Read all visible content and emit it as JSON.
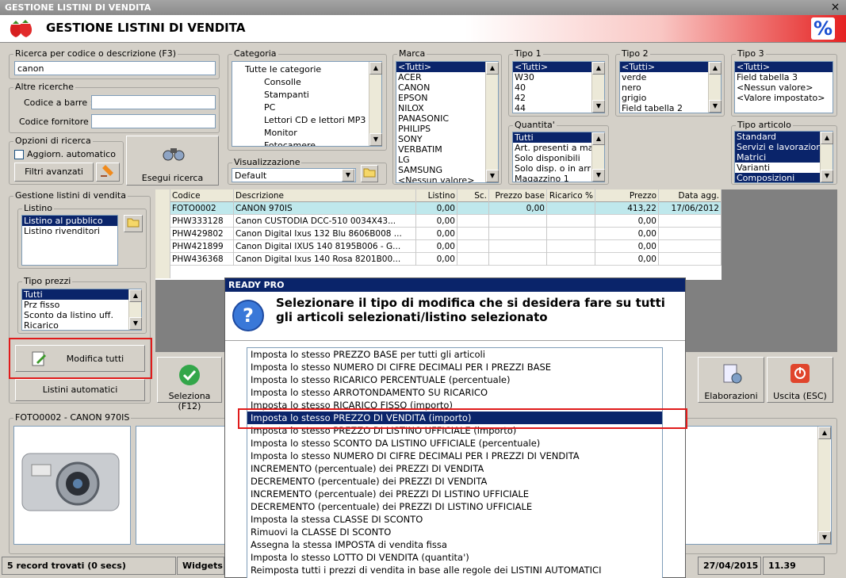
{
  "window": {
    "title": "GESTIONE LISTINI DI VENDITA",
    "close": "×"
  },
  "header": {
    "title": "GESTIONE LISTINI DI VENDITA",
    "logo": "strawberry",
    "percent_icon": "%"
  },
  "search": {
    "label": "Ricerca per codice o descrizione (F3)",
    "value": "canon"
  },
  "altre": {
    "label": "Altre ricerche",
    "barcode_label": "Codice a barre :",
    "supplier_label": "Codice fornitore :"
  },
  "opzioni": {
    "label": "Opzioni di ricerca",
    "auto_label": "Aggiorn. automatico",
    "filters_label": "Filtri avanzati"
  },
  "esegui": {
    "label": "Esegui ricerca"
  },
  "categoria": {
    "label": "Categoria",
    "items": [
      "Tutte le categorie",
      "Consolle",
      "Stampanti",
      "PC",
      "Lettori CD e lettori MP3",
      "Monitor",
      "Fotocamere"
    ]
  },
  "visualizzazione": {
    "label": "Visualizzazione",
    "value": "Default"
  },
  "marca": {
    "label": "Marca",
    "items": [
      "<Tutti>",
      "ACER",
      "CANON",
      "EPSON",
      "NILOX",
      "PANASONIC",
      "PHILIPS",
      "SONY",
      "VERBATIM",
      "LG",
      "SAMSUNG",
      "<Nessun valore>"
    ]
  },
  "tipo1": {
    "label": "Tipo 1",
    "items": [
      "<Tutti>",
      "W30",
      "40",
      "42",
      "44"
    ]
  },
  "tipo2": {
    "label": "Tipo 2",
    "items": [
      "<Tutti>",
      "verde",
      "nero",
      "grigio",
      "Field tabella 2"
    ]
  },
  "tipo3": {
    "label": "Tipo 3",
    "items": [
      "<Tutti>",
      "Field tabella 3",
      "<Nessun valore>",
      "<Valore impostato>"
    ]
  },
  "quantita": {
    "label": "Quantita'",
    "items": [
      "Tutti",
      "Art. presenti a maga",
      "Solo disponibili",
      "Solo disp. o in arrivo",
      "Magazzino 1"
    ]
  },
  "tipo_articolo": {
    "label": "Tipo articolo",
    "items": [
      "Standard",
      "Servizi e lavorazioni",
      "Matrici",
      "Varianti",
      "Composizioni"
    ]
  },
  "gestione": {
    "label": "Gestione listini di vendita",
    "listino_label": "Listino",
    "listino_items": [
      "Listino al pubblico",
      "Listino rivenditori"
    ],
    "tipo_prezzi_label": "Tipo prezzi",
    "tipo_prezzi_items": [
      "Tutti",
      "Prz fisso",
      "Sconto da listino uff.",
      "Ricarico"
    ],
    "modifica_label": "Modifica tutti",
    "automatici_label": "Listini automatici"
  },
  "grid": {
    "columns": [
      "Codice",
      "Descrizione",
      "Listino",
      "Sc.",
      "Prezzo base",
      "Ricarico %",
      "Prezzo",
      "Data agg."
    ],
    "rows": [
      [
        "FOTO0002",
        "CANON 970IS",
        "0,00",
        "",
        "0,00",
        "",
        "413,22",
        "17/06/2012"
      ],
      [
        "PHW333128",
        "Canon CUSTODIA DCC-510 0034X43...",
        "0,00",
        "",
        "",
        "",
        "0,00",
        ""
      ],
      [
        "PHW429802",
        "Canon Digital Ixus 132 Blu 8606B008 ...",
        "0,00",
        "",
        "",
        "",
        "0,00",
        ""
      ],
      [
        "PHW421899",
        "Canon Digital IXUS 140 8195B006 - G...",
        "0,00",
        "",
        "",
        "",
        "0,00",
        ""
      ],
      [
        "PHW436368",
        "Canon Digital Ixus 140 Rosa 8201B00...",
        "0,00",
        "",
        "",
        "",
        "0,00",
        ""
      ]
    ]
  },
  "buttons": {
    "seleziona": "Seleziona (F12)",
    "elaborazioni": "Elaborazioni",
    "uscita": "Uscita (ESC)"
  },
  "preview": {
    "label": "FOTO0002 - CANON 970IS"
  },
  "status": {
    "records": "5 record trovati (0 secs)",
    "widgets": "Widgets",
    "date": "27/04/2015",
    "time": "11.39"
  },
  "dialog": {
    "title": "READY PRO",
    "message": "Selezionare il tipo di modifica che si desidera fare su tutti gli articoli selezionati/listino selezionato",
    "options": [
      "Imposta lo stesso PREZZO BASE per tutti gli articoli",
      "Imposta lo stesso NUMERO DI CIFRE DECIMALI PER I PREZZI BASE",
      "Imposta lo stesso RICARICO PERCENTUALE (percentuale)",
      "Imposta lo stesso ARROTONDAMENTO SU RICARICO",
      "Imposta lo stesso RICARICO FISSO (importo)",
      "Imposta lo stesso PREZZO DI VENDITA (importo)",
      "Imposta lo stesso PREZZO DI LISTINO UFFICIALE (importo)",
      "Imposta lo stesso SCONTO DA LISTINO UFFICIALE (percentuale)",
      "Imposta lo stesso NUMERO DI CIFRE DECIMALI PER I PREZZI DI VENDITA",
      "INCREMENTO (percentuale) dei PREZZI DI VENDITA",
      "DECREMENTO (percentuale) dei PREZZI DI VENDITA",
      "INCREMENTO (percentuale) dei PREZZI DI LISTINO UFFICIALE",
      "DECREMENTO (percentuale) dei PREZZI DI LISTINO UFFICIALE",
      "Imposta la stessa CLASSE DI SCONTO",
      "Rimuovi la CLASSE DI SCONTO",
      "Assegna la stessa IMPOSTA di vendita fissa",
      "Imposta lo stesso LOTTO DI VENDITA (quantita')",
      "Reimposta tutti i prezzi di vendita in base alle regole dei LISTINI AUTOMATICI"
    ],
    "selected_index": 5
  },
  "colors": {
    "selection": "#0a246a",
    "highlight_row": "#bfe8ec",
    "accent_red": "#e01b1b"
  }
}
